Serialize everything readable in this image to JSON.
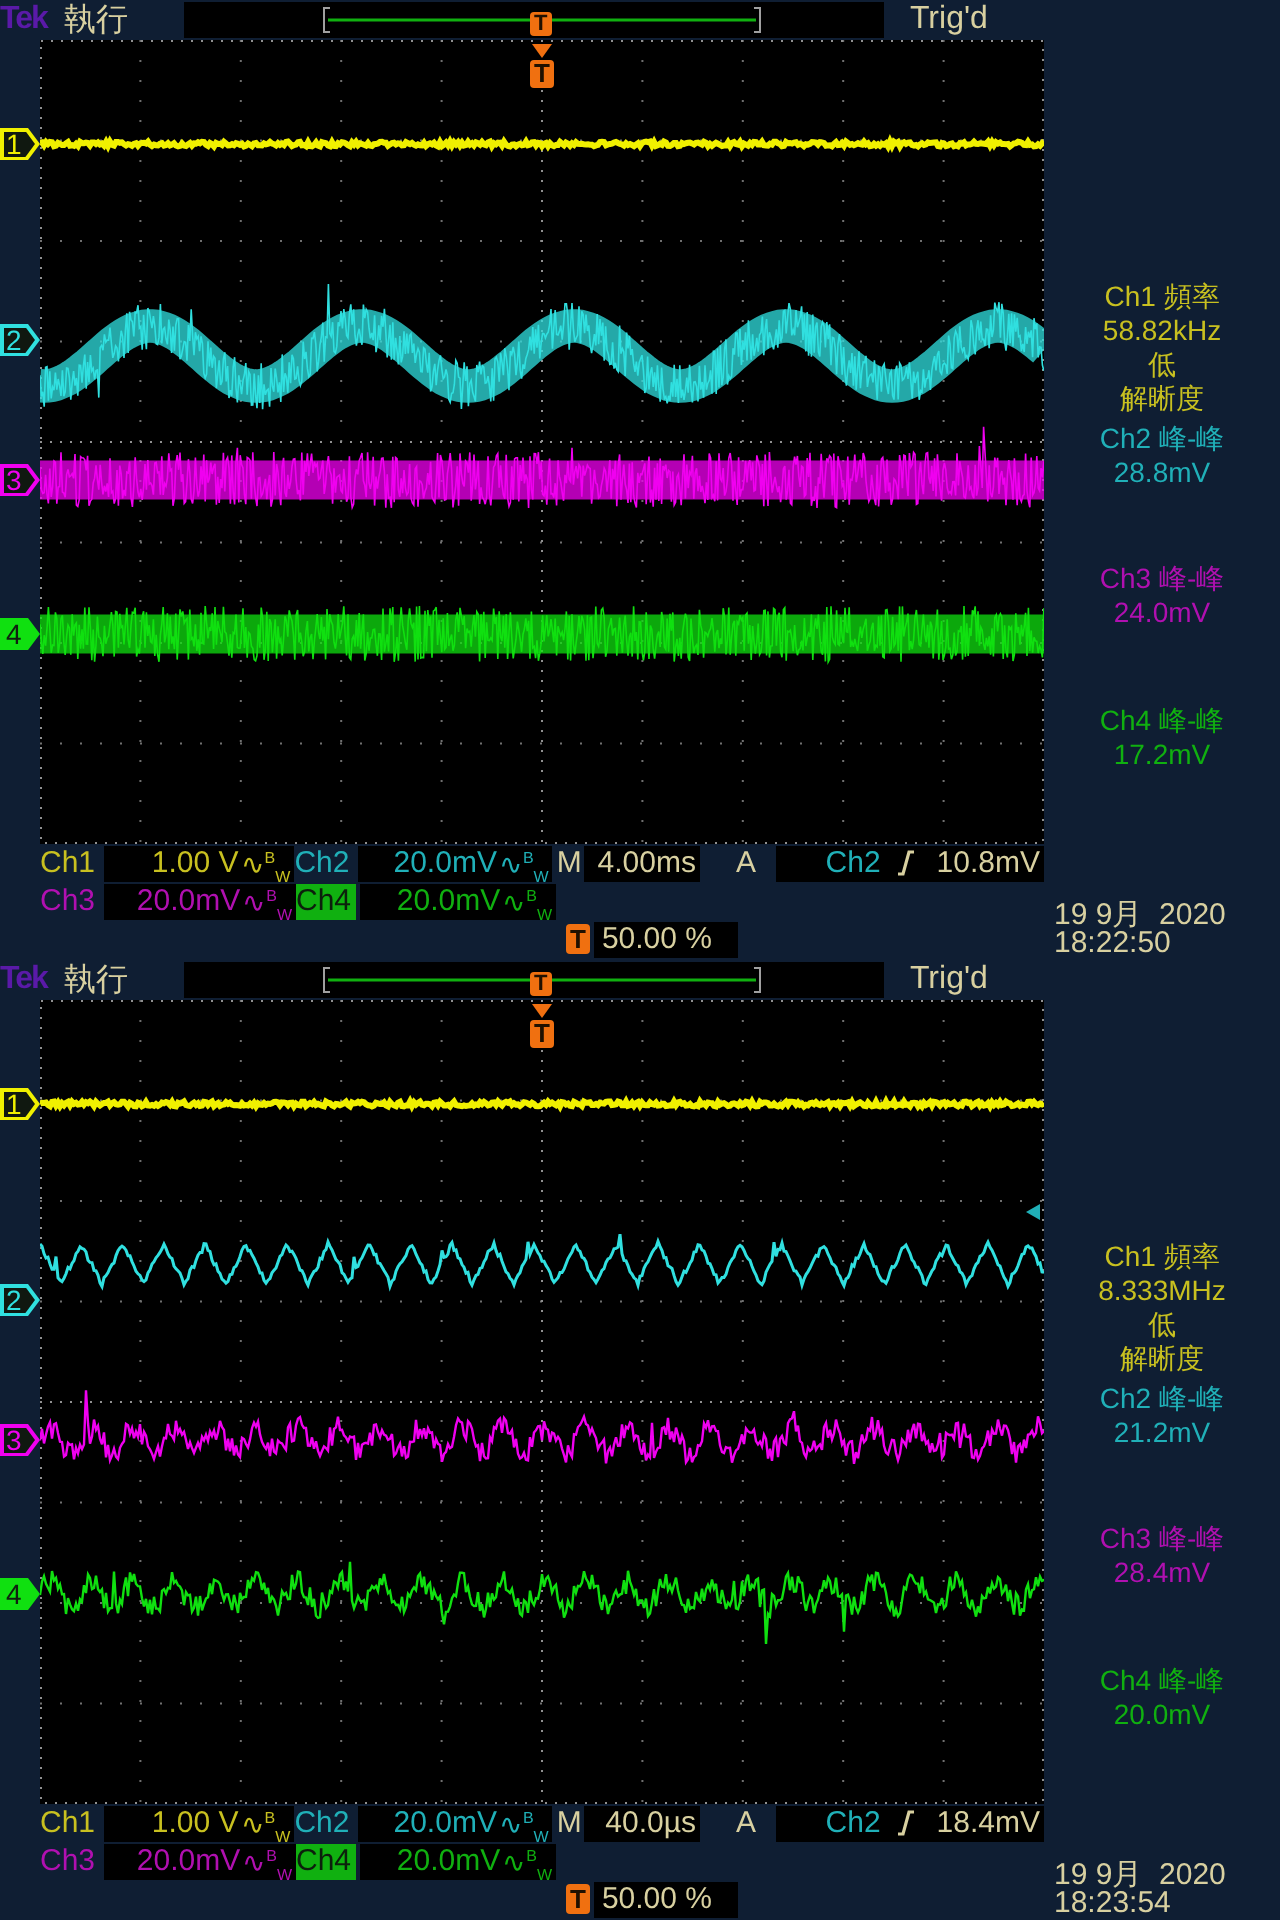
{
  "screens": [
    {
      "top_bar": {
        "brand": "Tek",
        "run_state": "執行",
        "record_marker": "T",
        "trigger_status": "Trig'd"
      },
      "trigger_marker": "T",
      "traces": [
        {
          "label": "1",
          "color": "#f0f000",
          "kind": "thin",
          "selected": false
        },
        {
          "label": "2",
          "color": "#30e0e0",
          "kind": "sine-band",
          "selected": false
        },
        {
          "label": "3",
          "color": "#f000f0",
          "kind": "band",
          "selected": false
        },
        {
          "label": "4",
          "color": "#10e010",
          "kind": "band",
          "selected": true
        }
      ],
      "measurements": [
        {
          "label": "Ch1 頻率",
          "value": "58.82kHz",
          "notes": [
            "低",
            "解晰度"
          ],
          "color": "#c8c020"
        },
        {
          "label": "Ch2 峰-峰",
          "value": "28.8mV",
          "color": "#20b0b8"
        },
        {
          "label": "Ch3 峰-峰",
          "value": "24.0mV",
          "color": "#b010b0"
        },
        {
          "label": "Ch4 峰-峰",
          "value": "17.2mV",
          "color": "#10b010"
        }
      ],
      "channel_settings": [
        {
          "label": "Ch1",
          "scale": "1.00 V",
          "bw": "∿$^{B}$$_{W}$",
          "color": "#c8c020",
          "selected": false
        },
        {
          "label": "Ch2",
          "scale": "20.0mV",
          "bw": "∿$^{B}$$_{W}$",
          "color": "#20b0b8",
          "selected": false
        },
        {
          "label": "Ch3",
          "scale": "20.0mV",
          "bw": "∿$^{B}$$_{W}$",
          "color": "#b010b0",
          "selected": false
        },
        {
          "label": "Ch4",
          "scale": "20.0mV",
          "bw": "∿$^{B}$$_{W}$",
          "color": "#10b010",
          "selected": true
        }
      ],
      "timebase": {
        "label": "M",
        "value": "4.00ms"
      },
      "trigger": {
        "mode": "A",
        "source": "Ch2",
        "level": "10.8mV"
      },
      "position": {
        "marker": "T",
        "value": "50.00 %"
      },
      "date": "19 9月  2020",
      "time": "18:22:50"
    },
    {
      "top_bar": {
        "brand": "Tek",
        "run_state": "執行",
        "record_marker": "T",
        "trigger_status": "Trig'd"
      },
      "trigger_marker": "T",
      "trigger_level_arrow": true,
      "traces": [
        {
          "label": "1",
          "color": "#f0f000",
          "kind": "thin",
          "selected": false
        },
        {
          "label": "2",
          "color": "#30e0e0",
          "kind": "zigzag",
          "selected": false
        },
        {
          "label": "3",
          "color": "#f000f0",
          "kind": "noisy-wave",
          "selected": false
        },
        {
          "label": "4",
          "color": "#10e010",
          "kind": "noisy-wave",
          "selected": true
        }
      ],
      "measurements": [
        {
          "label": "Ch1 頻率",
          "value": "8.333MHz",
          "notes": [
            "低",
            "解晰度"
          ],
          "color": "#c8c020"
        },
        {
          "label": "Ch2 峰-峰",
          "value": "21.2mV",
          "color": "#20b0b8"
        },
        {
          "label": "Ch3 峰-峰",
          "value": "28.4mV",
          "color": "#b010b0"
        },
        {
          "label": "Ch4 峰-峰",
          "value": "20.0mV",
          "color": "#10b010"
        }
      ],
      "channel_settings": [
        {
          "label": "Ch1",
          "scale": "1.00 V",
          "bw": "∿$^{B}$$_{W}$",
          "color": "#c8c020",
          "selected": false
        },
        {
          "label": "Ch2",
          "scale": "20.0mV",
          "bw": "∿$^{B}$$_{W}$",
          "color": "#20b0b8",
          "selected": false
        },
        {
          "label": "Ch3",
          "scale": "20.0mV",
          "bw": "∿$^{B}$$_{W}$",
          "color": "#b010b0",
          "selected": false
        },
        {
          "label": "Ch4",
          "scale": "20.0mV",
          "bw": "∿$^{B}$$_{W}$",
          "color": "#10b010",
          "selected": true
        }
      ],
      "timebase": {
        "label": "M",
        "value": "40.0µs"
      },
      "trigger": {
        "mode": "A",
        "source": "Ch2",
        "level": "18.4mV"
      },
      "position": {
        "marker": "T",
        "value": "50.00 %"
      },
      "date": "19 9月  2020",
      "time": "18:23:54"
    }
  ]
}
